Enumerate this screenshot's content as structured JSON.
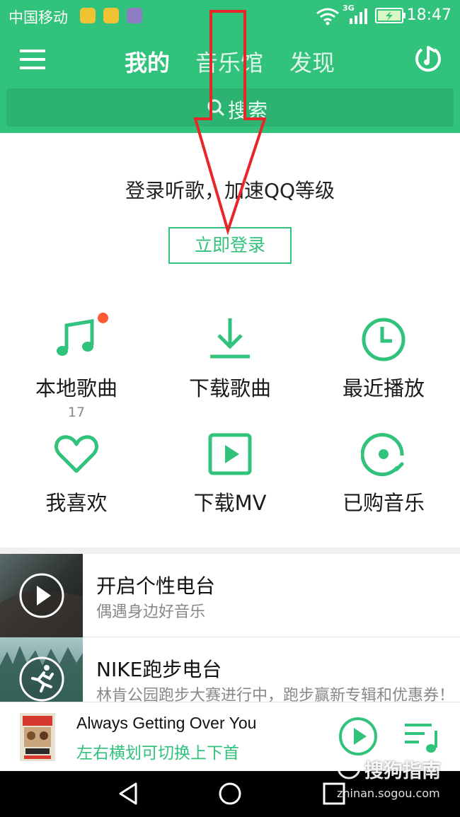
{
  "status_bar": {
    "carrier": "中国移动",
    "network": "3G",
    "time": "18:47"
  },
  "header": {
    "tabs": [
      "我的",
      "音乐馆",
      "发现"
    ],
    "active_tab_index": 0,
    "search_label": "搜索"
  },
  "login": {
    "prompt": "登录听歌，加速QQ等级",
    "button_label": "立即登录"
  },
  "grid": {
    "items": [
      {
        "label": "本地歌曲",
        "icon": "music-note-icon",
        "count": "17",
        "badge": true
      },
      {
        "label": "下载歌曲",
        "icon": "download-icon"
      },
      {
        "label": "最近播放",
        "icon": "clock-icon"
      },
      {
        "label": "我喜欢",
        "icon": "heart-icon"
      },
      {
        "label": "下载MV",
        "icon": "video-play-icon"
      },
      {
        "label": "已购音乐",
        "icon": "disc-icon"
      }
    ]
  },
  "radio": {
    "items": [
      {
        "title": "开启个性电台",
        "subtitle": "偶遇身边好音乐",
        "icon": "play-circle-icon"
      },
      {
        "title": "NIKE跑步电台",
        "subtitle": "林肯公园跑步大赛进行中，跑步赢新专辑和优惠券！",
        "icon": "runner-icon"
      }
    ]
  },
  "mini_player": {
    "song": "Always Getting Over You",
    "hint": "左右横划可切换上下首"
  },
  "watermark": {
    "brand": "搜狗指南",
    "domain": "zhinan.sogou.com"
  },
  "colors": {
    "accent": "#31c27c",
    "badge": "#ff5a32",
    "annotation": "#e8262a"
  }
}
